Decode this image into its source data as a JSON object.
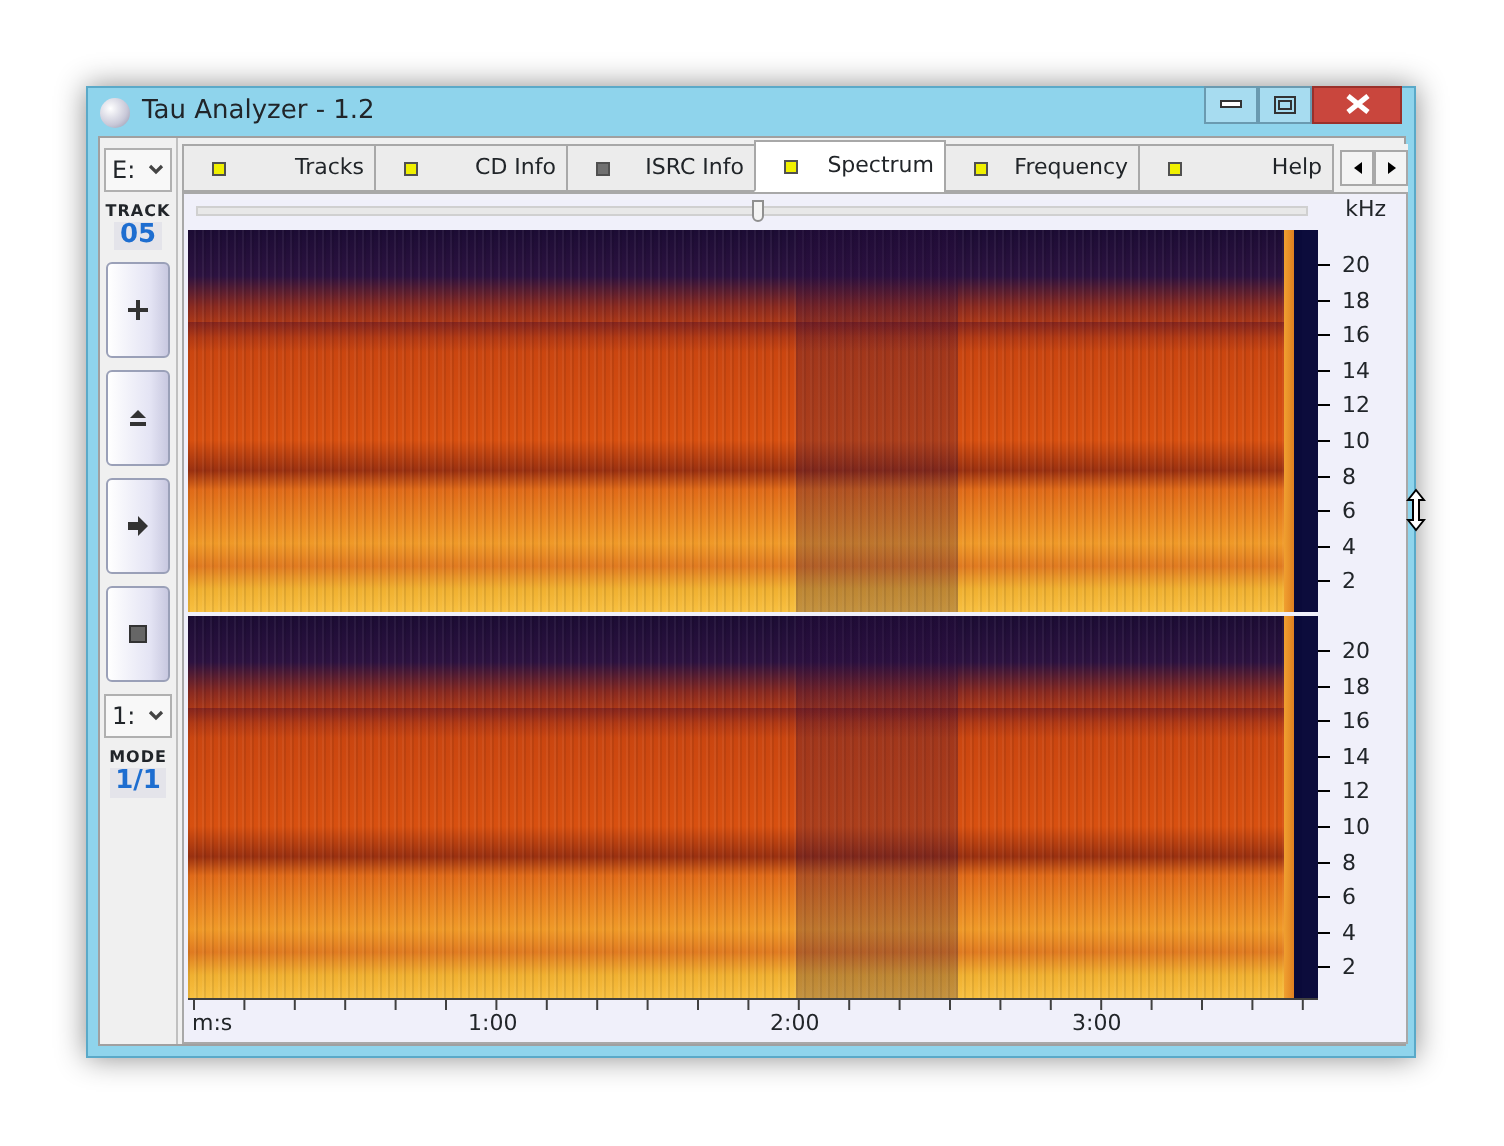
{
  "window": {
    "title": "Tau Analyzer - 1.2"
  },
  "side_panel": {
    "drive": "E:",
    "track_label": "TRACK",
    "track": "05",
    "mode_select": "1:",
    "mode_label": "MODE",
    "mode": "1/1"
  },
  "tabs": [
    {
      "label": "Tracks",
      "color": "#f0f000",
      "selected": false
    },
    {
      "label": "CD Info",
      "color": "#f0f000",
      "selected": false
    },
    {
      "label": "ISRC Info",
      "color": "#707070",
      "selected": false
    },
    {
      "label": "Spectrum",
      "color": "#f0f000",
      "selected": true
    },
    {
      "label": "Frequency",
      "color": "#f0f000",
      "selected": false
    },
    {
      "label": "Help",
      "color": "#f0f000",
      "selected": false
    }
  ],
  "slider": {
    "level": 0.5
  },
  "frequency_axis": {
    "unit": "kHz"
  },
  "channels": [
    {
      "labels": [
        "20",
        "18",
        "16",
        "14",
        "12",
        "10",
        "8",
        "6",
        "4",
        "2"
      ]
    },
    {
      "labels": [
        "20",
        "18",
        "16",
        "14",
        "12",
        "10",
        "8",
        "6",
        "4",
        "2"
      ]
    }
  ],
  "time_axis": {
    "unit": "m:s",
    "labels": [
      "1:00",
      "2:00",
      "3:00"
    ]
  }
}
